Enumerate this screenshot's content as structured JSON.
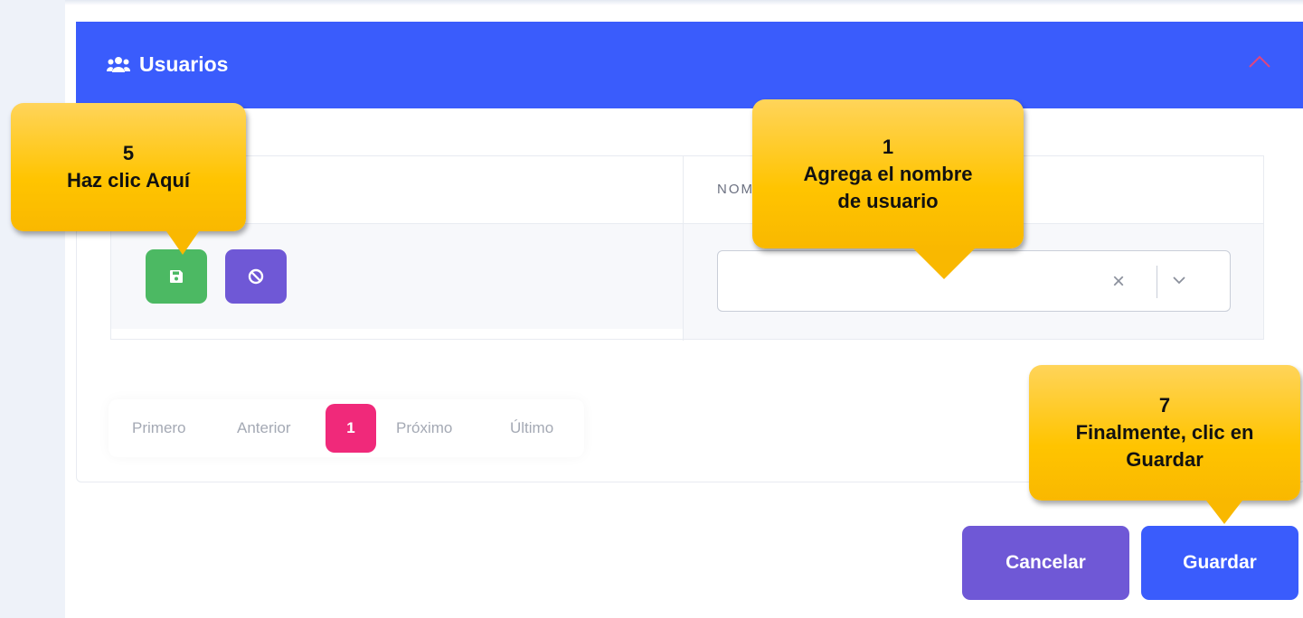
{
  "panel": {
    "title": "Usuarios"
  },
  "table": {
    "column_header": "NOMBRE"
  },
  "pagination": {
    "first": "Primero",
    "previous": "Anterior",
    "current": "1",
    "next": "Próximo",
    "last": "Último"
  },
  "actions": {
    "cancel_label": "Cancelar",
    "save_label": "Guardar"
  },
  "callouts": [
    {
      "number": "5",
      "text": "Haz clic Aquí"
    },
    {
      "number": "1",
      "text_line1": "Agrega el nombre",
      "text_line2": "de usuario"
    },
    {
      "number": "7",
      "text_line1": "Finalmente, clic en",
      "text_line2": "Guardar"
    }
  ],
  "icons": [
    "users-icon",
    "chevron-up-icon",
    "floppy-disk-icon",
    "ban-icon",
    "clear-x-icon",
    "chevron-down-icon"
  ],
  "colors": {
    "primary": "#3a5cfc",
    "success": "#4cb963",
    "purple": "#6f58d6",
    "pink": "#f0297a",
    "callout": "#ffc400"
  }
}
